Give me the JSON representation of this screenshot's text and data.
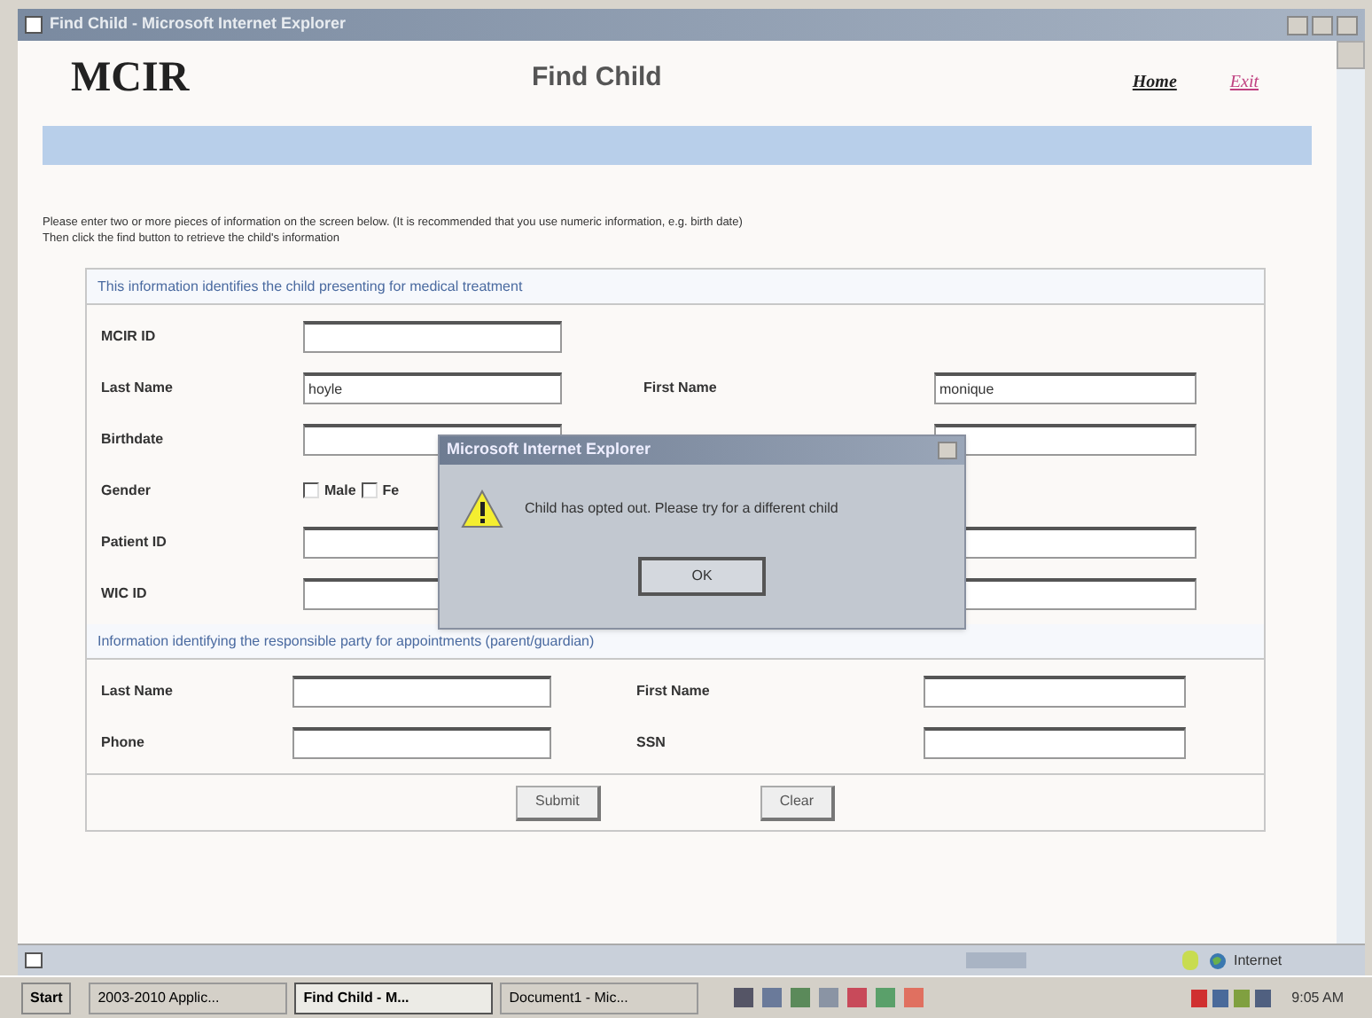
{
  "window": {
    "title": "Find Child - Microsoft Internet Explorer"
  },
  "header": {
    "logo": "MCIR",
    "title": "Find Child",
    "links": [
      {
        "label": "Home",
        "kind": "home"
      },
      {
        "label": "Exit",
        "kind": "exit"
      }
    ]
  },
  "instructions": [
    "Please enter two or more pieces of information on the screen below. (It is recommended that you use numeric information, e.g. birth date)",
    "Then click the find button to retrieve the child's information"
  ],
  "sections": [
    {
      "heading": "This information identifies the child presenting for medical treatment",
      "rows": [
        {
          "kind": "field",
          "label": "MCIR ID",
          "right_field": false
        },
        {
          "kind": "field",
          "label": "Last Name",
          "value": "hoyle",
          "right": {
            "label": "First Name",
            "value": "monique"
          }
        },
        {
          "kind": "field",
          "label": "Birthdate",
          "right_field": true
        },
        {
          "kind": "gender",
          "label": "Gender",
          "options": [
            {
              "label": "Male",
              "checked": false
            },
            {
              "label": "Fe",
              "checked": false
            }
          ]
        },
        {
          "kind": "field",
          "label": "Patient ID",
          "right_field": true
        },
        {
          "kind": "field",
          "label": "WIC ID",
          "right_field": true
        }
      ]
    },
    {
      "heading": "Information identifying the responsible party for appointments (parent/guardian)",
      "rows": [
        {
          "kind": "field",
          "label": "Last Name",
          "right": {
            "label": "First Name"
          }
        },
        {
          "kind": "field",
          "label": "Phone",
          "right": {
            "label": "SSN"
          }
        }
      ]
    }
  ],
  "buttons": [
    "Submit",
    "Clear"
  ],
  "dialog": {
    "title": "Microsoft Internet Explorer",
    "message": "Child has opted out. Please try for a different child",
    "button": "OK"
  },
  "status_bar": {
    "zone": "Internet"
  },
  "taskbar": {
    "start": "Start",
    "tasks": [
      {
        "label": "2003-2010 Applic...",
        "selected": false
      },
      {
        "label": "Find Child - M...",
        "selected": true
      },
      {
        "label": "Document1 - Mic...",
        "selected": false
      }
    ],
    "clock": "9:05 AM"
  }
}
